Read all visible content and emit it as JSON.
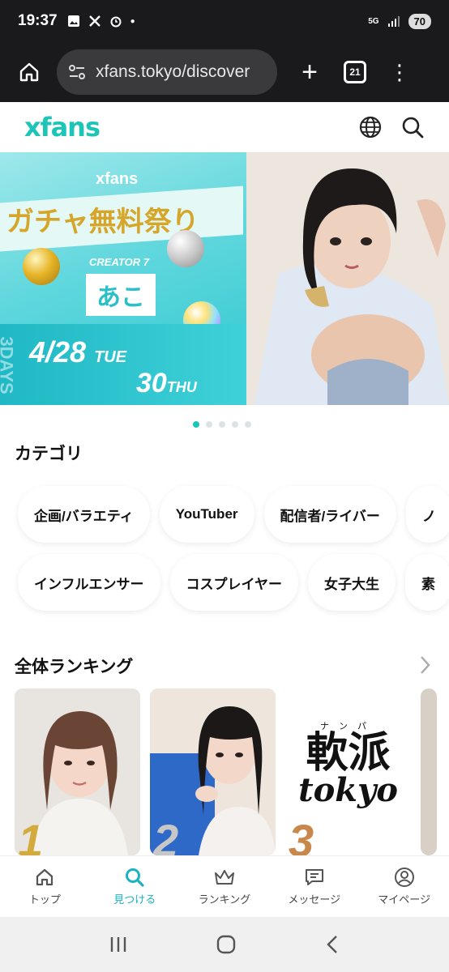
{
  "status_bar": {
    "time": "19:37",
    "network": "5G",
    "battery": "70"
  },
  "browser": {
    "url": "xfans.tokyo/discover",
    "tab_count": "21"
  },
  "header": {
    "logo": "xfans"
  },
  "banner": {
    "brand": "xfans",
    "title": "ガチャ無料祭り",
    "creator_label": "CREATOR 7",
    "creator_name": "あこ",
    "date_start": "4/28",
    "day_start": "TUE",
    "date_end": "30",
    "day_end": "THU",
    "side_text": "3DAYS"
  },
  "carousel": {
    "count": 5,
    "active": 0
  },
  "categories": {
    "title": "カテゴリ",
    "row1": [
      "企画/バラエティ",
      "YouTuber",
      "配信者/ライバー",
      "ノ"
    ],
    "row2": [
      "インフルエンサー",
      "コスプレイヤー",
      "女子大生",
      "素"
    ]
  },
  "ranking": {
    "title": "全体ランキング",
    "items": [
      {
        "rank": "1"
      },
      {
        "rank": "2"
      },
      {
        "rank": "3",
        "logo_top": "ナンパ",
        "logo_main": "軟派",
        "logo_sub": "tokyo"
      }
    ]
  },
  "bottom_nav": [
    {
      "label": "トップ",
      "icon": "home-icon"
    },
    {
      "label": "見つける",
      "icon": "search-icon",
      "active": true
    },
    {
      "label": "ランキング",
      "icon": "crown-icon"
    },
    {
      "label": "メッセージ",
      "icon": "message-icon"
    },
    {
      "label": "マイページ",
      "icon": "person-icon"
    }
  ]
}
